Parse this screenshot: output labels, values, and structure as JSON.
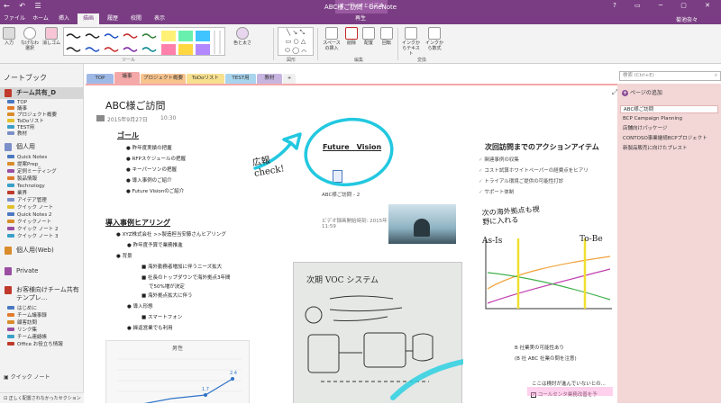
{
  "window": {
    "title": "ABC様ご訪問 - OneNote",
    "contextual_group": "オーディオとビデオ",
    "user": "菊池奈々",
    "quick_access": "← ↶ ☰"
  },
  "ribbon_tabs": [
    {
      "label": "ファイル"
    },
    {
      "label": "ホーム"
    },
    {
      "label": "挿入"
    },
    {
      "label": "描画"
    },
    {
      "label": "履歴"
    },
    {
      "label": "校閲"
    },
    {
      "label": "表示"
    },
    {
      "label": "再生"
    }
  ],
  "ribbon": {
    "input_label": "入力",
    "lasso_label": "なげなわ選択",
    "eraser_label": "消しゴム",
    "pens_group": "ツール",
    "color_label": "色と太さ",
    "shapes_group": "図形",
    "space_label": "スペースの挿入",
    "delete_label": "削除",
    "arrange_label": "配置",
    "rotate_label": "回転",
    "edit_group": "編集",
    "ink_to_text": "インクからテキスト",
    "ink_to_math": "インクから数式",
    "convert_group": "変換"
  },
  "leftnav": {
    "header": "ノートブック",
    "notebooks": [
      {
        "name": "チーム共有_D",
        "color": "#c0392b"
      },
      {
        "name": "個人用",
        "color": "#7b8fc9"
      },
      {
        "name": "個人用(Web)",
        "color": "#d98c2b"
      },
      {
        "name": "Private",
        "color": "#9a4fa3"
      },
      {
        "name": "お客様向けチーム共有テンプレ...",
        "color": "#c0392b"
      }
    ],
    "team_sections": [
      {
        "label": "TOP",
        "color": "#4a78c2"
      },
      {
        "label": "議事",
        "color": "#e07b2b"
      },
      {
        "label": "プロジェクト概要",
        "color": "#d98c2b"
      },
      {
        "label": "ToDoリスト",
        "color": "#e0c02b"
      },
      {
        "label": "TEST用",
        "color": "#3aa0c9"
      },
      {
        "label": "教材",
        "color": "#7b8fc9"
      }
    ],
    "personal_sections": [
      {
        "label": "Quick Notes",
        "color": "#4a78c2"
      },
      {
        "label": "提案Prep_",
        "color": "#d98c2b"
      },
      {
        "label": "定例ミーティング",
        "color": "#9a4fa3"
      },
      {
        "label": "製品情報",
        "color": "#e07b2b"
      },
      {
        "label": "Technology",
        "color": "#3aa0c9"
      },
      {
        "label": "業界",
        "color": "#c0392b"
      },
      {
        "label": "アイデア管理",
        "color": "#7b8fc9"
      },
      {
        "label": "クイック ノート",
        "color": "#e0c02b"
      },
      {
        "label": "Quick Notes 2",
        "color": "#4a78c2"
      },
      {
        "label": "クイックノート",
        "color": "#d98c2b"
      },
      {
        "label": "クイック ノート 2",
        "color": "#9a4fa3"
      },
      {
        "label": "クイック ノート 3",
        "color": "#3aa0c9"
      }
    ],
    "template_sections": [
      {
        "label": "はじめに",
        "color": "#4a78c2"
      },
      {
        "label": "チーム議事録",
        "color": "#e07b2b"
      },
      {
        "label": "顧客訪問",
        "color": "#d98c2b"
      },
      {
        "label": "リンク集",
        "color": "#9a4fa3"
      },
      {
        "label": "チーム連絡帳",
        "color": "#3aa0c9"
      },
      {
        "label": "Office お役立ち情報",
        "color": "#c0392b"
      }
    ],
    "quick_note": "クイック ノート",
    "status": "正しく配置されなかったセクション"
  },
  "section_tabs": [
    {
      "label": "TOP",
      "color": "#9fb9e6"
    },
    {
      "label": "議事",
      "color": "#f4a8a8"
    },
    {
      "label": "プロジェクト概要",
      "color": "#f7c48e"
    },
    {
      "label": "ToDoリスト",
      "color": "#f7e08e"
    },
    {
      "label": "TEST用",
      "color": "#a8d4ee"
    },
    {
      "label": "教材",
      "color": "#c7b5e0"
    },
    {
      "label": "+",
      "color": "#f0f0f0"
    }
  ],
  "search": {
    "placeholder": "検索 (Ctrl+E)"
  },
  "pages": {
    "add_label": "ページの追加",
    "items": [
      {
        "label": "ABC様ご訪問"
      },
      {
        "label": "BCP Campaign Planning"
      },
      {
        "label": "店舗向けパッケージ"
      },
      {
        "label": "CONTOSO事業継続BCPプロジェクト"
      },
      {
        "label": "新製品販売に向けたプレスト"
      }
    ]
  },
  "note": {
    "title": "ABC様ご訪問",
    "date": "2015年9月27日",
    "time": "10:30",
    "goal_heading": "ゴール",
    "goal_items": [
      "昨年度実績の把握",
      "RFPスケジュールの把握",
      "キーパーソンの把握",
      "導入事例のご紹介",
      "Future Visionのご紹介"
    ],
    "future_heading": "Future　Vision",
    "attachment_name": "ABC様ご訪問 - 2",
    "video_caption": "ビデオ録画開始時刻: 2015年 11:59",
    "action_heading": "次回訪問までのアクションアイテム",
    "action_items": [
      "関連事例の収集",
      "コスト試算ホワイトペーパーの経費点をヒアリ",
      "トライアル環境ご提供の可能性打診",
      "サポート体制"
    ],
    "case_heading": "導入事例ヒアリング",
    "case_items": [
      {
        "text": "XYZ株式会社 >>製造担当安藤さんヒアリング",
        "level": 1
      },
      {
        "text": "昨年度予算で業務推進",
        "level": 2
      },
      {
        "text": "背景",
        "level": 1
      },
      {
        "text": "海外勤務者増加に伴うニーズ拡大",
        "level": 3
      },
      {
        "text": "社長のトップダウンで海外拠点3年間",
        "level": 3
      },
      {
        "text": "で50%増が決定",
        "level": 3
      },
      {
        "text": "海外拠点拡大に伴う",
        "level": 3
      },
      {
        "text": "導入形態",
        "level": 2
      },
      {
        "text": "スマートフォン",
        "level": 3
      },
      {
        "text": "繰返営業でも利用",
        "level": 2
      }
    ],
    "chart_title": "男性",
    "ink_left": "広報check!",
    "ink_chart_note": "次の海外拠点も視野に入れる",
    "ink_as_is": "As-Is",
    "ink_to_be": "To-Be",
    "bottom_note_1": "B 社業実の可能性あり",
    "bottom_note_2": "(B 社 ABC 社業の問を注意)",
    "bottom_note_3": "ここは検討が進んでいないとの...",
    "bottom_note_4": "コールセンタ業務改善を予",
    "whiteboard_text": "次期 VOC システム"
  }
}
